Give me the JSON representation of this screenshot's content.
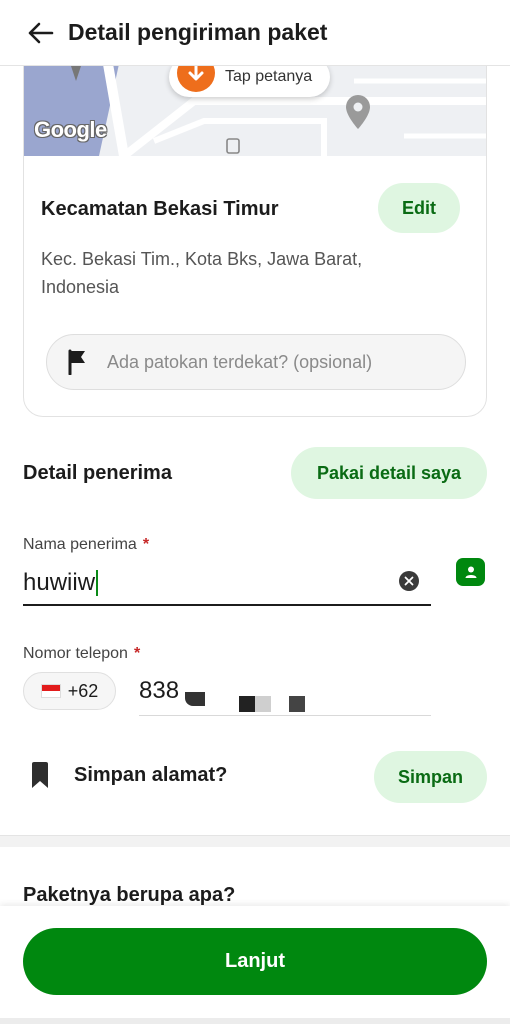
{
  "header": {
    "title": "Detail pengiriman paket"
  },
  "map": {
    "tap_label": "Tap petanya",
    "google_logo": "Google"
  },
  "location": {
    "title": "Kecamatan Bekasi Timur",
    "edit_label": "Edit",
    "address": "Kec. Bekasi Tim., Kota Bks, Jawa Barat, Indonesia",
    "landmark_placeholder": "Ada patokan terdekat? (opsional)"
  },
  "recipient": {
    "section_title": "Detail penerima",
    "use_my_details_label": "Pakai detail saya",
    "name_label": "Nama penerima",
    "required_mark": "*",
    "name_value": "huwiiw",
    "phone_label": "Nomor telepon",
    "country_code": "+62",
    "phone_value": "838"
  },
  "save_address": {
    "question": "Simpan alamat?",
    "button_label": "Simpan"
  },
  "package": {
    "title": "Paketnya berupa apa?"
  },
  "footer": {
    "continue_label": "Lanjut"
  },
  "colors": {
    "primary_green": "#00880f",
    "light_green": "#dff6e1",
    "dark_green_text": "#0a6b14",
    "required_red": "#c62828",
    "pin_orange": "#ee6e1c"
  }
}
